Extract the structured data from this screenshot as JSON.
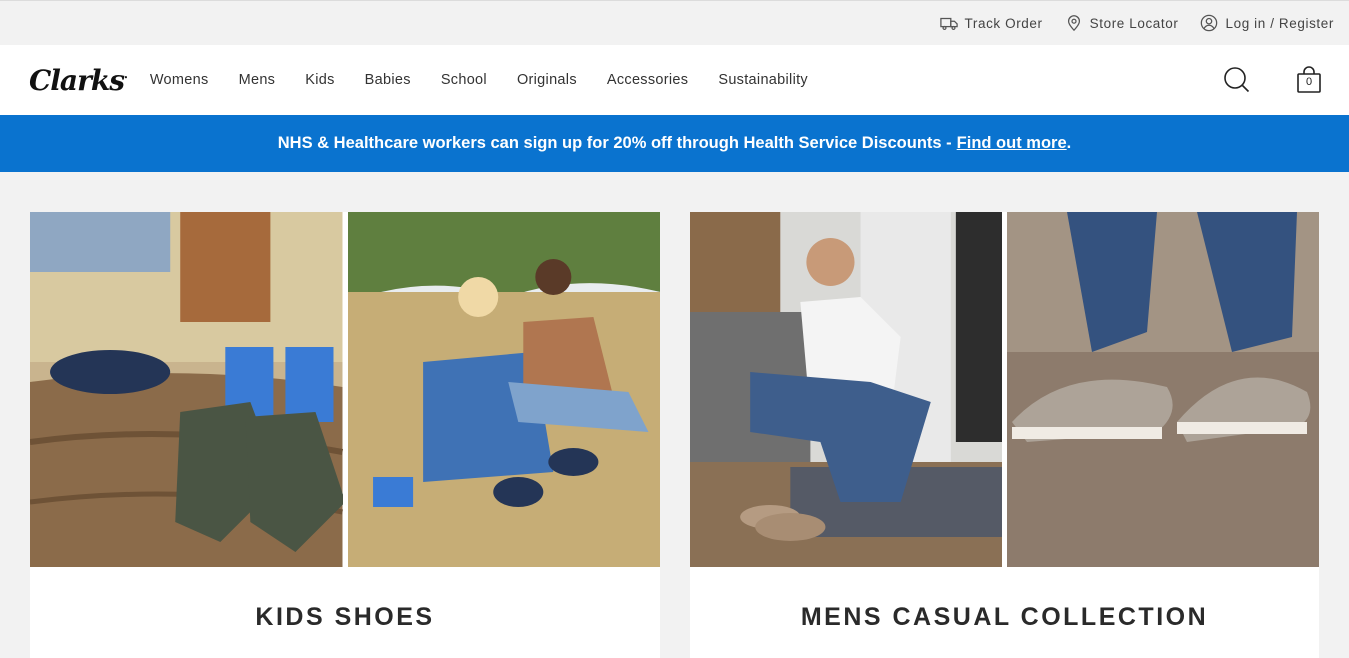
{
  "utility": {
    "track_order": "Track Order",
    "store_locator": "Store Locator",
    "login": "Log in / Register"
  },
  "brand": {
    "logo": "Clarks"
  },
  "nav": {
    "items": [
      "Womens",
      "Mens",
      "Kids",
      "Babies",
      "School",
      "Originals",
      "Accessories",
      "Sustainability"
    ],
    "bag_count": "0"
  },
  "promo": {
    "text": "NHS & Healthcare workers can sign up for 20% off through Health Service Discounts -",
    "link": "Find out more",
    "suffix": "."
  },
  "cards": [
    {
      "title": "KIDS SHOES"
    },
    {
      "title": "MENS CASUAL COLLECTION"
    }
  ],
  "colors": {
    "promo_blue": "#0a73cf",
    "page_bg": "#f2f2f2"
  },
  "icons": [
    "truck-icon",
    "pin-icon",
    "user-icon",
    "search-icon",
    "bag-icon"
  ]
}
